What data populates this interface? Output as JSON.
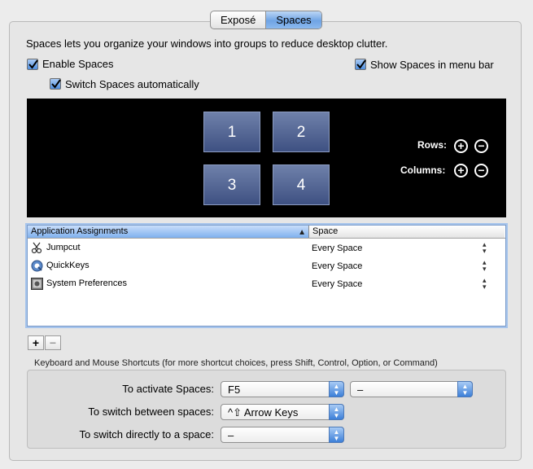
{
  "tabs": [
    {
      "label": "Exposé",
      "selected": false
    },
    {
      "label": "Spaces",
      "selected": true
    }
  ],
  "description": "Spaces lets you organize your windows into groups to reduce desktop clutter.",
  "options": {
    "enable_spaces": {
      "label": "Enable Spaces",
      "checked": true
    },
    "switch_auto": {
      "label": "Switch Spaces automatically",
      "checked": true
    },
    "show_menu_bar": {
      "label": "Show Spaces in menu bar",
      "checked": true
    }
  },
  "spaces": [
    "1",
    "2",
    "3",
    "4"
  ],
  "grid_controls": {
    "rows_label": "Rows:",
    "columns_label": "Columns:",
    "plus": "+",
    "minus": "−"
  },
  "table": {
    "columns": [
      "Application Assignments",
      "Space"
    ],
    "rows": [
      {
        "app": "Jumpcut",
        "space": "Every Space",
        "icon": "scissors-icon"
      },
      {
        "app": "QuickKeys",
        "space": "Every Space",
        "icon": "quickkeys-icon"
      },
      {
        "app": "System Preferences",
        "space": "Every Space",
        "icon": "system-preferences-icon"
      }
    ]
  },
  "list_buttons": {
    "add": "+",
    "remove": "−"
  },
  "shortcuts": {
    "title": "Keyboard and Mouse Shortcuts (for more shortcut choices, press Shift, Control, Option, or Command)",
    "activate": {
      "label": "To activate Spaces:",
      "value": "F5",
      "secondary": "–"
    },
    "switch_between": {
      "label": "To switch between spaces:",
      "value": "^⇧ Arrow Keys"
    },
    "switch_direct": {
      "label": "To switch directly to a space:",
      "value": "–"
    }
  },
  "colors": {
    "accent": "#4f8fe0",
    "space_tile": "#4e5f8f",
    "grid_bg": "#000000"
  }
}
